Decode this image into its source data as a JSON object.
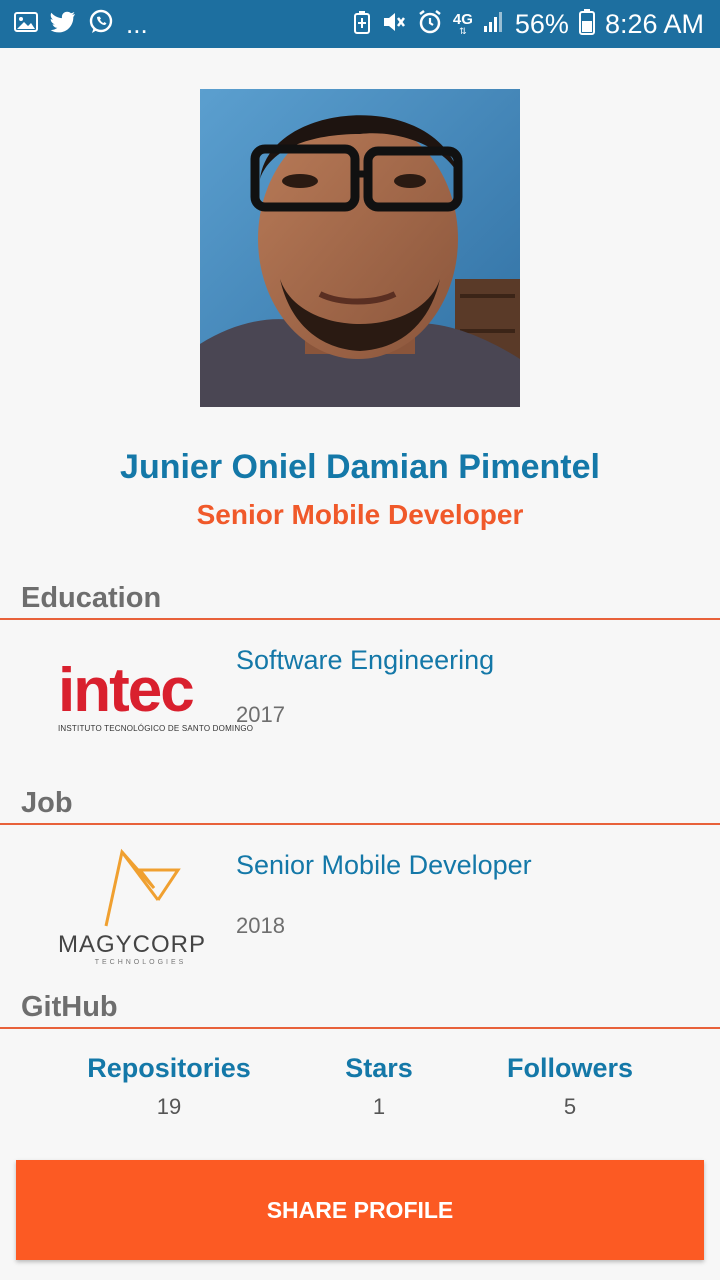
{
  "status_bar": {
    "icons_left": [
      "gallery-icon",
      "twitter-icon",
      "whatsapp-icon"
    ],
    "more": "...",
    "network": "4G",
    "battery": "56%",
    "time": "8:26 AM"
  },
  "profile": {
    "name": "Junier Oniel Damian Pimentel",
    "title": "Senior Mobile Developer"
  },
  "education": {
    "section_title": "Education",
    "logo_text": "intec",
    "logo_subtext": "INSTITUTO TECNOLÓGICO DE SANTO DOMINGO",
    "degree": "Software Engineering",
    "year": "2017"
  },
  "job": {
    "section_title": "Job",
    "logo_text": "MAGYCORP",
    "logo_subtext": "TECHNOLOGIES",
    "position": "Senior Mobile Developer",
    "year": "2018"
  },
  "github": {
    "section_title": "GitHub",
    "stats": [
      {
        "label": "Repositories",
        "value": "19"
      },
      {
        "label": "Stars",
        "value": "1"
      },
      {
        "label": "Followers",
        "value": "5"
      }
    ]
  },
  "actions": {
    "share_label": "SHARE PROFILE"
  },
  "colors": {
    "accent_blue": "#1478a8",
    "accent_orange": "#f0592a",
    "button_orange": "#fc5a23",
    "status_bar": "#1d6fa0"
  }
}
